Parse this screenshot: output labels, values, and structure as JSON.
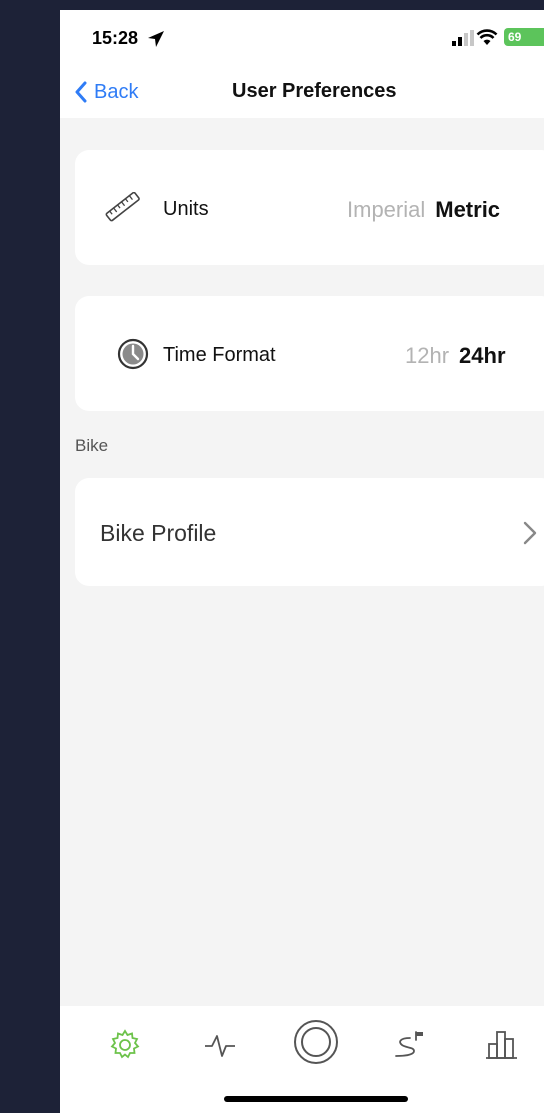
{
  "status": {
    "time": "15:28",
    "battery": "69"
  },
  "nav": {
    "back_label": "Back",
    "title": "User Preferences"
  },
  "units": {
    "label": "Units",
    "options": [
      "Imperial",
      "Metric"
    ],
    "selected": "Metric"
  },
  "time_format": {
    "label": "Time Format",
    "options": [
      "12hr",
      "24hr"
    ],
    "selected": "24hr"
  },
  "bike_section": {
    "title": "Bike",
    "profile_label": "Bike Profile"
  },
  "tabs": [
    {
      "icon": "gear-icon",
      "active": true
    },
    {
      "icon": "activity-icon",
      "active": false
    },
    {
      "icon": "record-icon",
      "active": false
    },
    {
      "icon": "route-icon",
      "active": false
    },
    {
      "icon": "stats-icon",
      "active": false
    }
  ],
  "colors": {
    "accent": "#2f7cf6",
    "active_tab": "#6cc24a",
    "battery": "#5cc45b",
    "background": "#1d2237"
  }
}
